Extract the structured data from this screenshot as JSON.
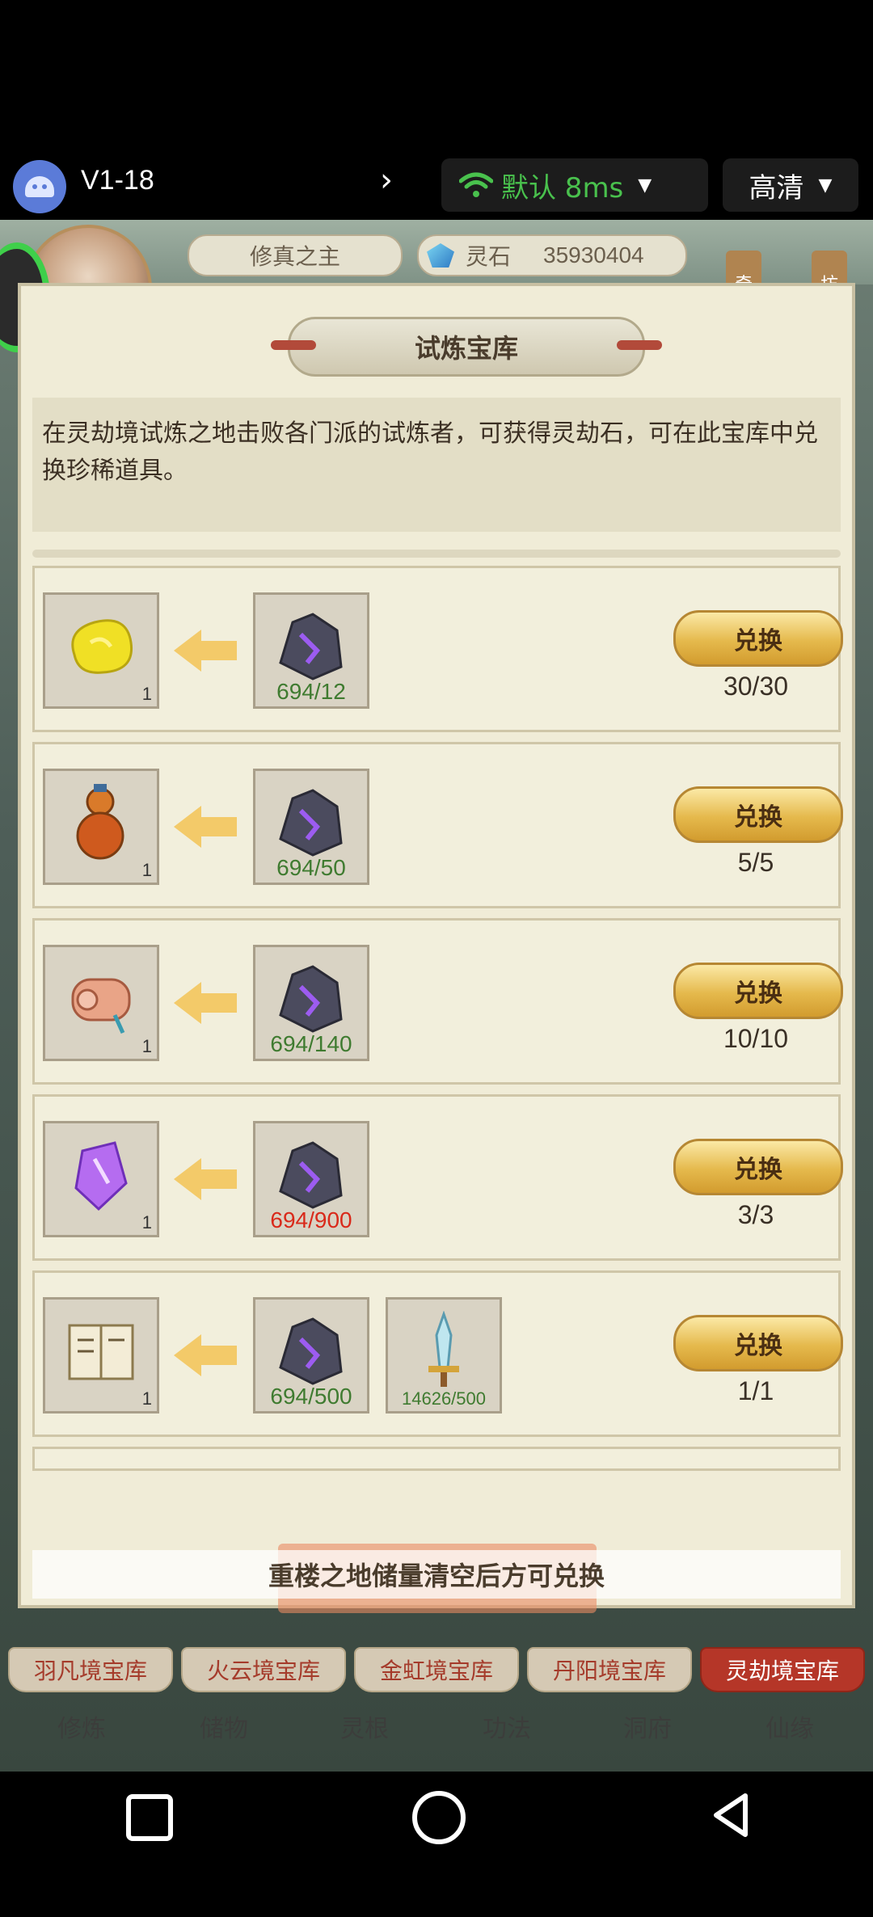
{
  "topbar": {
    "version": "V1-18",
    "network_label": "默认 8ms",
    "quality_label": "高清",
    "colors": {
      "network": "#49c14d"
    }
  },
  "header": {
    "player_title": "修真之主",
    "currency_label": "灵石",
    "currency_value": "35930404",
    "side_tags": [
      "奇",
      "坊"
    ]
  },
  "panel": {
    "title": "试炼宝库",
    "description": "在灵劫境试炼之地击败各门派的试炼者，可获得灵劫石，可在此宝库中兑换珍稀道具。",
    "rows": [
      {
        "reward_icon": "yellow-stone-icon",
        "reward_qty": "1",
        "cost_icon": "spirit-stone-icon",
        "cost": "694/12",
        "cost_ok": true,
        "button": "兑换",
        "limit": "30/30"
      },
      {
        "reward_icon": "gourd-icon",
        "reward_qty": "1",
        "cost_icon": "spirit-stone-icon",
        "cost": "694/50",
        "cost_ok": true,
        "button": "兑换",
        "limit": "5/5"
      },
      {
        "reward_icon": "scroll-icon",
        "reward_qty": "1",
        "cost_icon": "spirit-stone-icon",
        "cost": "694/140",
        "cost_ok": true,
        "button": "兑换",
        "limit": "10/10"
      },
      {
        "reward_icon": "purple-crystal-icon",
        "reward_qty": "1",
        "cost_icon": "spirit-stone-icon",
        "cost": "694/900",
        "cost_ok": false,
        "button": "兑换",
        "limit": "3/3"
      },
      {
        "reward_icon": "book-icon",
        "reward_qty": "1",
        "cost_icon": "spirit-stone-icon",
        "cost": "694/500",
        "cost_ok": true,
        "extra_cost_icon": "sword-icon",
        "extra_cost": "14626/500",
        "button": "兑换",
        "limit": "1/1"
      }
    ],
    "notice": "重楼之地储量清空后方可兑换"
  },
  "tabs": [
    "羽凡境宝库",
    "火云境宝库",
    "金虹境宝库",
    "丹阳境宝库",
    "灵劫境宝库"
  ],
  "active_tab": "灵劫境宝库",
  "menu": [
    "修炼",
    "储物",
    "灵根",
    "功法",
    "洞府",
    "仙缘"
  ]
}
